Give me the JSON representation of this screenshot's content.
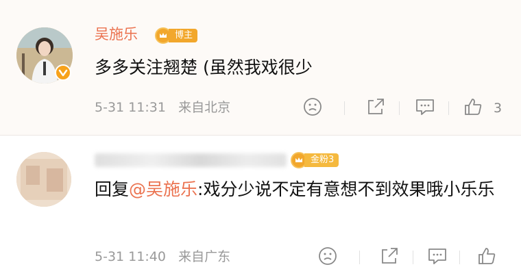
{
  "comments": [
    {
      "author": "吴施乐",
      "badge_label": "博主",
      "text": "多多关注翘楚 (虽然我戏很少",
      "time": "5-31 11:31",
      "source": "来自北京",
      "likes": "3"
    },
    {
      "badge_label": "金粉3",
      "reply_prefix": "回复",
      "mention": "@吴施乐",
      "text": ":戏分少说不定有意想不到效果哦小乐乐",
      "time": "5-31 11:40",
      "source": "来自广东"
    }
  ],
  "icons": [
    "face-icon",
    "share-icon",
    "comment-icon",
    "like-icon",
    "verified-icon",
    "crown-icon"
  ],
  "colors": {
    "accent": "#eb7350",
    "badge": "#f2a72c",
    "meta": "#999999"
  }
}
